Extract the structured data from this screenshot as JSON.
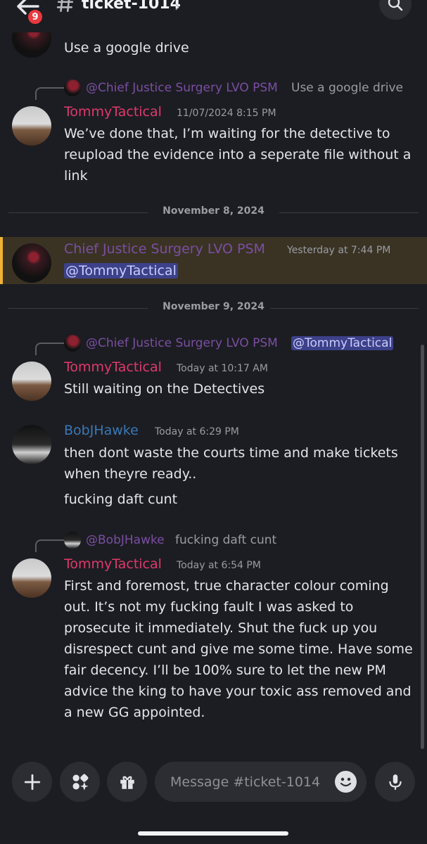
{
  "header": {
    "channel": "ticket-1014",
    "unread_badge": "9"
  },
  "messages": {
    "m0": {
      "text": "Use a google drive"
    },
    "m1": {
      "reply_author": "@Chief Justice Surgery LVO PSM",
      "reply_text": "Use a google drive",
      "author": "TommyTactical",
      "timestamp": "11/07/2024 8:15 PM",
      "text": "We’ve done that, I’m waiting for the detective to reupload the evidence into a seperate file without a link"
    },
    "divider1": "November 8, 2024",
    "m2": {
      "author": "Chief Justice Surgery LVO PSM",
      "timestamp": "Yesterday at 7:44 PM",
      "text": "@TommyTactical"
    },
    "divider2": "November 9, 2024",
    "m3": {
      "reply_author": "@Chief Justice Surgery LVO PSM",
      "reply_text": "@TommyTactical",
      "author": "TommyTactical",
      "timestamp": "Today at 10:17 AM",
      "text": "Still waiting on the Detectives"
    },
    "m4": {
      "author": "BobJHawke",
      "timestamp": "Today at 6:29 PM",
      "text": "then dont waste the courts time and make tickets when theyre ready..",
      "text2": "fucking daft cunt"
    },
    "m5": {
      "reply_author": "@BobJHawke",
      "reply_text": "fucking daft cunt",
      "author": "TommyTactical",
      "timestamp": "Today at 6:54 PM",
      "text": "First and foremost, true character colour coming out. It’s not my fucking fault I was asked to prosecute it immediately. Shut the fuck up you disrespect cunt and give me some time. Have some fair decency. I’ll be 100% sure to let the new PM advice the king to have your toxic ass removed and a new GG appointed."
    }
  },
  "composer": {
    "placeholder": "Message #ticket-1014"
  },
  "colors": {
    "tommy": "#e0396b",
    "chief": "#7b4ea3",
    "bob": "#3a78b6",
    "highlight": "#3a3324",
    "highlight_bar": "#f0b232"
  }
}
